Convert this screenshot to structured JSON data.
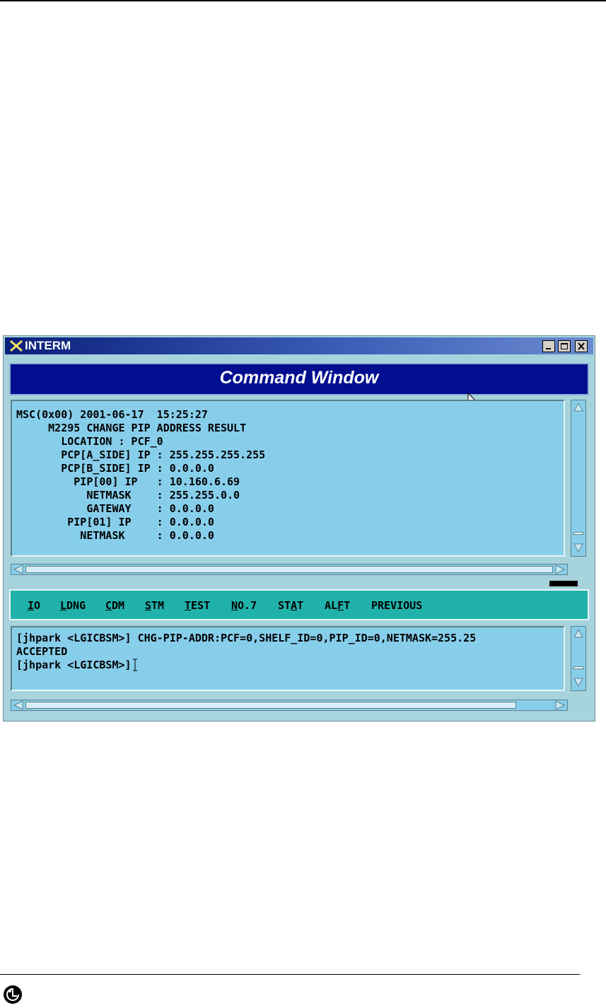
{
  "window": {
    "title": "INTERM",
    "header_label": "Command Window"
  },
  "output_lines": [
    "MSC(0x00) 2001-06-17  15:25:27",
    "     M2295 CHANGE PIP ADDRESS RESULT",
    "       LOCATION : PCF_0",
    "       PCP[A_SIDE] IP : 255.255.255.255",
    "       PCP[B_SIDE] IP : 0.0.0.0",
    "         PIP[00] IP   : 10.160.6.69",
    "           NETMASK    : 255.255.0.0",
    "           GATEWAY    : 0.0.0.0",
    "        PIP[01] IP    : 0.0.0.0",
    "          NETMASK     : 0.0.0.0"
  ],
  "menu": [
    {
      "pre": "",
      "u": "I",
      "post": "O"
    },
    {
      "pre": "",
      "u": "L",
      "post": "DNG"
    },
    {
      "pre": "",
      "u": "C",
      "post": "DM"
    },
    {
      "pre": "",
      "u": "S",
      "post": "TM"
    },
    {
      "pre": "",
      "u": "T",
      "post": "EST"
    },
    {
      "pre": "",
      "u": "N",
      "post": "O.7"
    },
    {
      "pre": "ST",
      "u": "A",
      "post": "T"
    },
    {
      "pre": "AL",
      "u": "F",
      "post": "T"
    },
    {
      "pre": "PREVIOUS",
      "u": "",
      "post": ""
    }
  ],
  "input_lines": [
    "[jhpark <LGICBSM>] CHG-PIP-ADDR:PCF=0,SHELF_ID=0,PIP_ID=0,NETMASK=255.25",
    "ACCEPTED",
    "[jhpark <LGICBSM>]"
  ],
  "icons": {
    "app": "x-logo-icon",
    "minimize": "minimize-icon",
    "maximize": "maximize-icon",
    "close": "close-icon",
    "brand": "lg-logo-icon"
  },
  "colors": {
    "title_bar": "#0a1f7a",
    "header_bg": "#000e8f",
    "pane_bg": "#87ceeb",
    "menu_bg": "#20b2aa"
  }
}
